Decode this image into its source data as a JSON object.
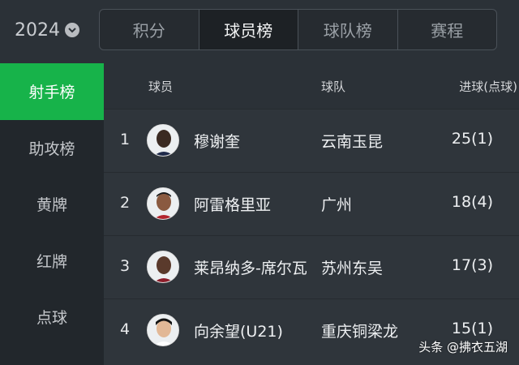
{
  "header": {
    "year": "2024",
    "tabs": [
      {
        "label": "积分"
      },
      {
        "label": "球员榜"
      },
      {
        "label": "球队榜"
      },
      {
        "label": "赛程"
      }
    ],
    "active_tab": "球员榜"
  },
  "sidebar": {
    "items": [
      {
        "label": "射手榜"
      },
      {
        "label": "助攻榜"
      },
      {
        "label": "黄牌"
      },
      {
        "label": "红牌"
      },
      {
        "label": "点球"
      }
    ],
    "active_item": "射手榜"
  },
  "table": {
    "columns": {
      "player": "球员",
      "team": "球队",
      "goals": "进球(点球)"
    },
    "rows": [
      {
        "rank": "1",
        "name": "穆谢奎",
        "team": "云南玉昆",
        "goals": "25(1)"
      },
      {
        "rank": "2",
        "name": "阿雷格里亚",
        "team": "广州",
        "goals": "18(4)"
      },
      {
        "rank": "3",
        "name": "莱昂纳多-席尔瓦",
        "team": "苏州东吴",
        "goals": "17(3)"
      },
      {
        "rank": "4",
        "name": "向余望(U21)",
        "team": "重庆铜梁龙",
        "goals": "15(1)"
      }
    ]
  },
  "credit": "头条 @拂衣五湖",
  "colors": {
    "accent": "#17b34a",
    "background": "#2b3137",
    "sidebar": "#22272c",
    "active_tab": "#1d2125"
  }
}
